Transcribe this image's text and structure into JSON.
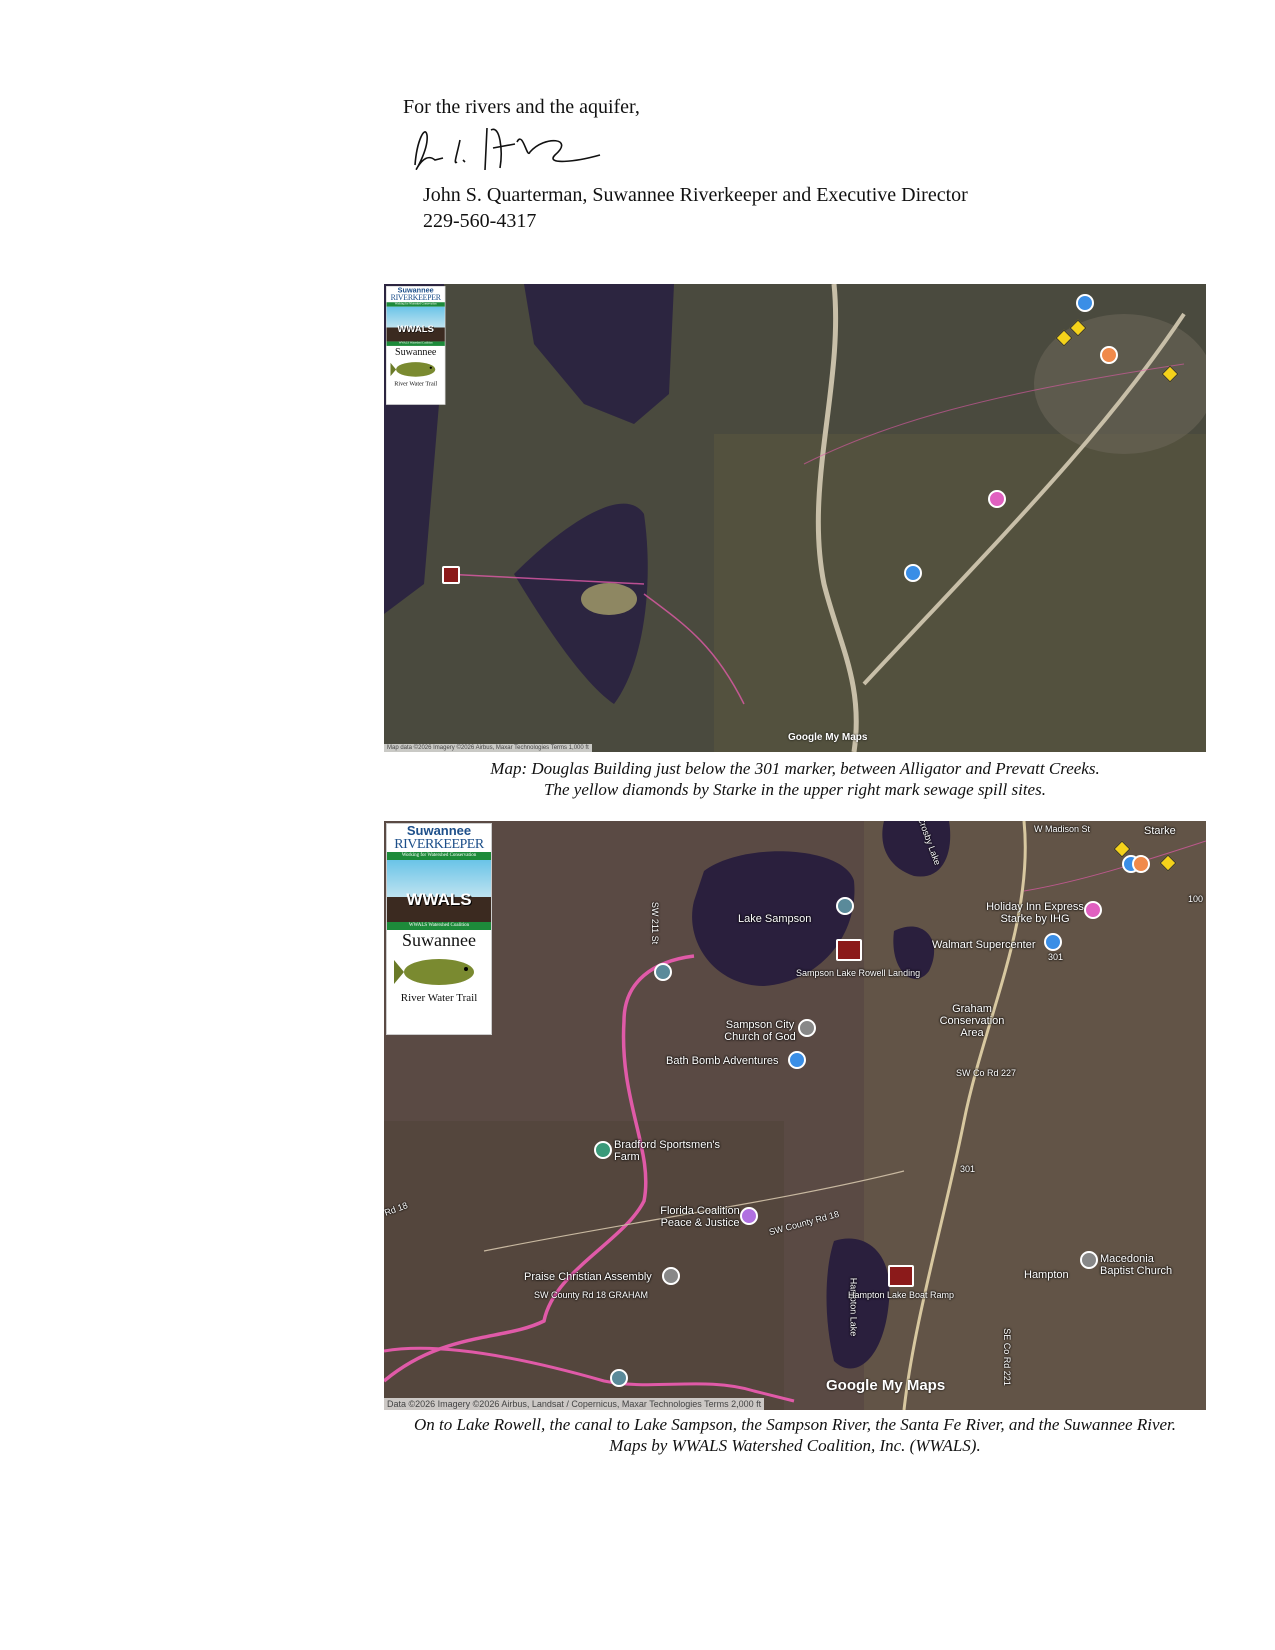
{
  "letter": {
    "closing": "For the rivers and the aquifer,",
    "signature": "John S. Quarterman",
    "signer": "John S. Quarterman, Suwannee Riverkeeper and Executive Director",
    "phone": "229-560-4317"
  },
  "logo": {
    "line1": "Suwannee",
    "line2": "RIVERKEEPER",
    "band1": "Working for Watershed Conservation",
    "wwals": "WWALS",
    "band2": "WWALS Watershed Coalition",
    "line3": "Suwannee",
    "line4": "River Water Trail"
  },
  "map1": {
    "brand": "Google My Maps",
    "attribution": "Map data ©2026 Imagery ©2026 Airbus, Maxar Technologies  Terms  1,000 ft",
    "colors": {
      "trail": "#e05aa8",
      "spill_marker": "#f4d21a"
    },
    "caption": [
      "Map: Douglas Building just below the 301 marker, between Alligator and Prevatt Creeks.",
      "The yellow diamonds by Starke in the upper right mark sewage spill sites."
    ]
  },
  "map2": {
    "labels": {
      "lake_sampson": "Lake Sampson",
      "crosby_lake": "Crosby Lake",
      "starke": "Starke",
      "w_madison": "W Madison St",
      "holiday_inn": "Holiday Inn Express Starke by IHG",
      "walmart": "Walmart Supercenter",
      "graham": "Graham Conservation Area",
      "sampson_landing": "Sampson Lake Rowell Landing",
      "church": "Sampson City Church of God",
      "bath_bomb": "Bath Bomb Adventures",
      "bradford": "Bradford Sportsmen's Farm",
      "fcpj": "Florida Coalition Peace & Justice",
      "sw_county_18": "SW County Rd 18",
      "praise": "Praise Christian Assembly",
      "graham_rd": "SW County Rd 18 GRAHAM",
      "hampton_lake": "Hampton Lake",
      "hampton_ramp": "Hampton Lake Boat Ramp",
      "hampton": "Hampton",
      "macedonia": "Macedonia Baptist Church",
      "sw_co_227": "SW Co Rd 227",
      "se_co_221": "SE Co Rd 221",
      "rd_301": "301",
      "rd_100": "100",
      "sw_211": "SW 211 St",
      "rd_18": "Rd 18"
    },
    "brand": "Google My Maps",
    "attribution": "Data ©2026 Imagery ©2026 Airbus, Landsat / Copernicus, Maxar Technologies   Terms   2,000 ft",
    "colors": {
      "trail": "#e05aa8",
      "spill_marker": "#f4d21a",
      "lake": "#2a1f3d"
    },
    "caption": [
      "On to Lake Rowell, the canal to Lake Sampson, the Sampson River, the Santa Fe River, and the Suwannee River.",
      "Maps by WWALS Watershed Coalition, Inc. (WWALS)."
    ]
  }
}
